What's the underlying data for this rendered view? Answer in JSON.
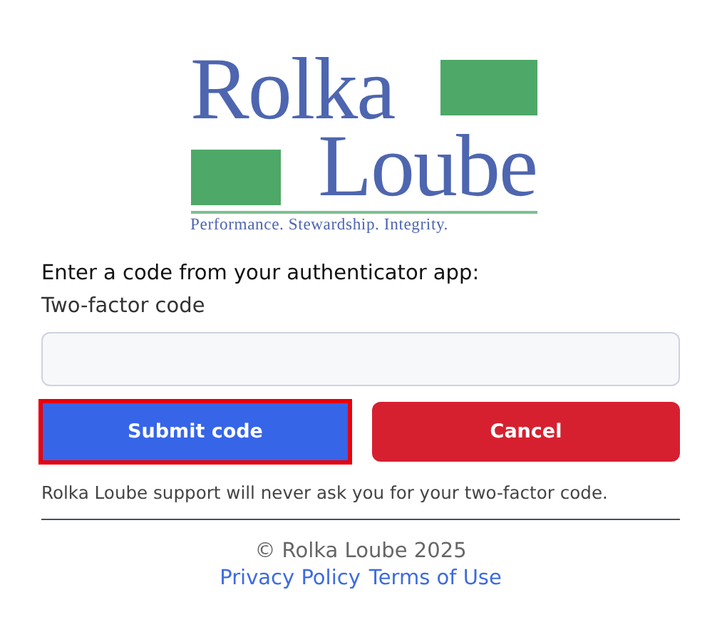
{
  "logo": {
    "line_1": "Rolka",
    "line_2": "Loube",
    "tagline": "Performance. Stewardship. Integrity."
  },
  "prompt": "Enter a code from your authenticator app:",
  "field": {
    "label": "Two-factor code"
  },
  "buttons": [
    {
      "label": "Submit code",
      "kind": "primary",
      "focused": true
    },
    {
      "label": "Cancel",
      "kind": "danger",
      "focused": false
    }
  ],
  "notice": "Rolka Loube support will never ask you for your two-factor code.",
  "footer": {
    "copyright": "© Rolka Loube 2025",
    "links": [
      "Privacy Policy",
      "Terms of Use"
    ]
  }
}
